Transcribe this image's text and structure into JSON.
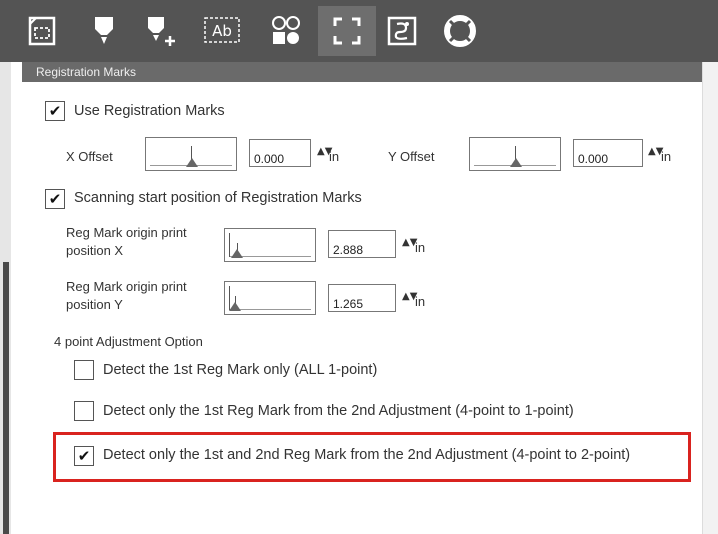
{
  "toolbar": {
    "buttons": [
      {
        "icon": "page-setup-icon"
      },
      {
        "icon": "pen-icon"
      },
      {
        "icon": "pen-add-icon"
      },
      {
        "icon": "text-ab-icon",
        "glyph": "Ab"
      },
      {
        "icon": "shapes-icon"
      },
      {
        "icon": "registration-marks-icon",
        "active": true
      },
      {
        "icon": "trace-icon"
      },
      {
        "icon": "help-lifebuoy-icon"
      }
    ]
  },
  "section": {
    "title": "Registration Marks"
  },
  "use_reg_marks": {
    "label": "Use Registration Marks",
    "checked": true
  },
  "offsets": {
    "x": {
      "label": "X Offset",
      "value": "0.000",
      "unit": "in"
    },
    "y": {
      "label": "Y Offset",
      "value": "0.000",
      "unit": "in"
    }
  },
  "scan_start": {
    "label": "Scanning start position of Registration Marks",
    "checked": true
  },
  "origin": {
    "x": {
      "label_line1": "Reg Mark origin print",
      "label_line2": "position X",
      "value": "2.888",
      "unit": "in"
    },
    "y": {
      "label_line1": "Reg Mark origin print",
      "label_line2": "position Y",
      "value": "1.265",
      "unit": "in"
    }
  },
  "adjustment": {
    "heading": "4 point Adjustment Option",
    "options": [
      {
        "label": "Detect the 1st Reg Mark only (ALL 1-point)",
        "checked": false
      },
      {
        "label": "Detect only the 1st Reg Mark from the 2nd Adjustment (4-point to 1-point)",
        "checked": false
      },
      {
        "label": "Detect only the 1st and 2nd Reg Mark from the 2nd Adjustment (4-point to 2-point)",
        "checked": true
      }
    ]
  },
  "glyphs": {
    "check": "✔",
    "spin": "▲▼"
  }
}
